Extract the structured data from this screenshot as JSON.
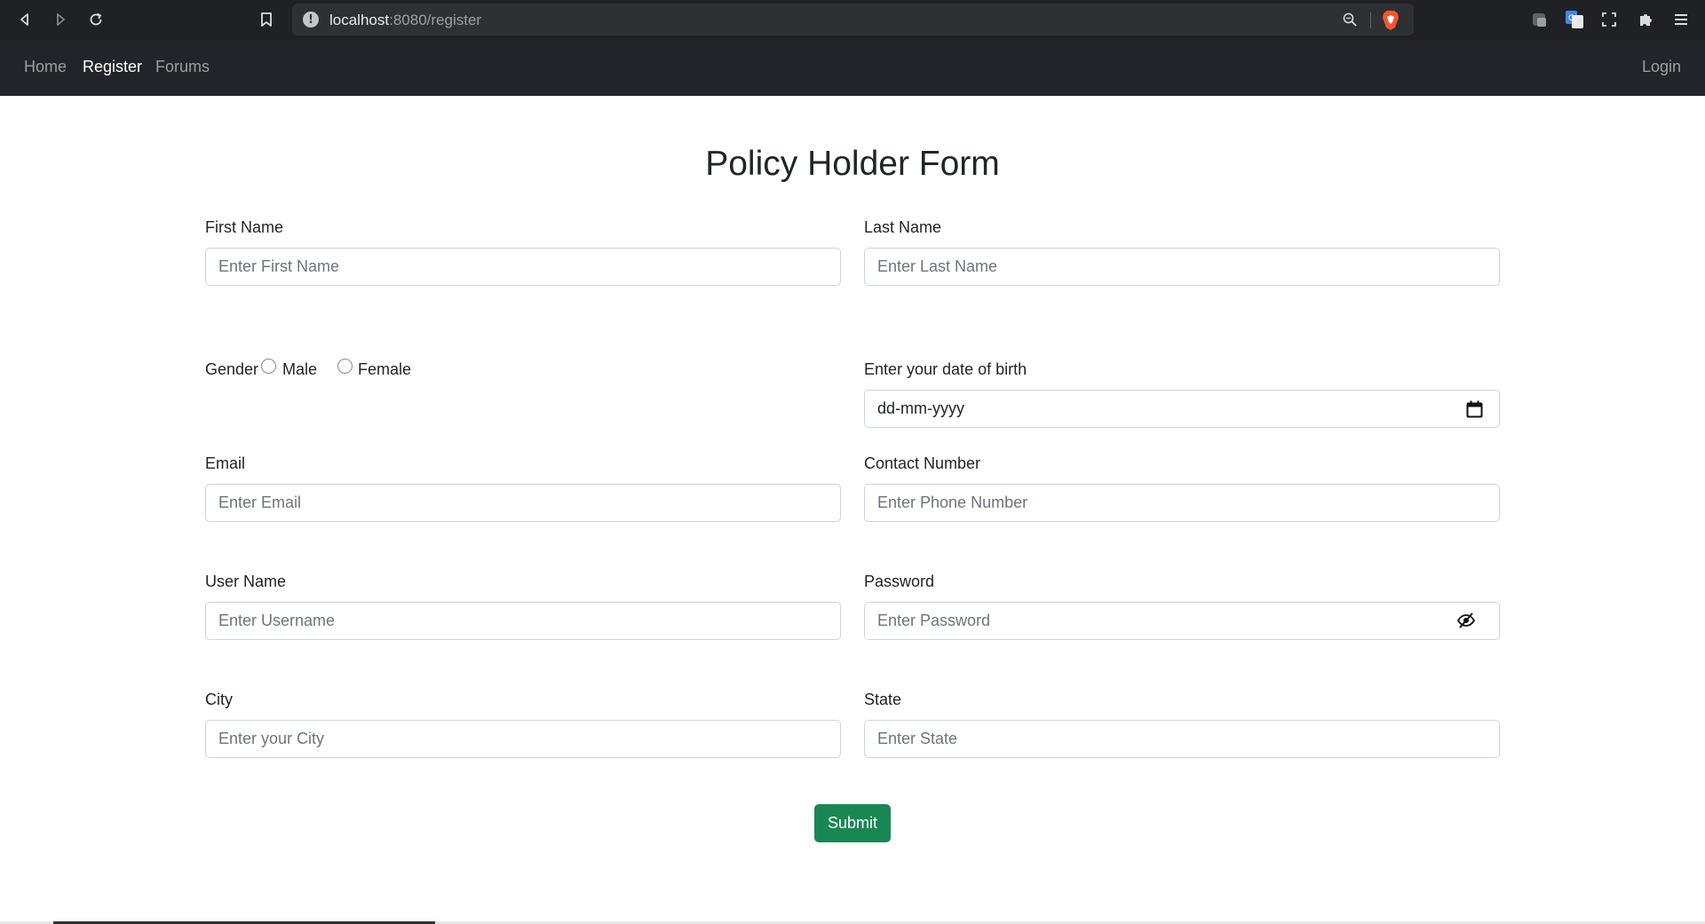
{
  "browser": {
    "url_host": "localhost",
    "url_path": ":8080/register",
    "info_glyph": "!",
    "icons": [
      "back-icon",
      "forward-icon",
      "reload-icon",
      "bookmark-icon",
      "zoom-icon",
      "brave-shield-icon",
      "extension-icon",
      "translate-icon",
      "screenshot-icon",
      "puzzle-icon",
      "menu-icon"
    ]
  },
  "navbar": {
    "home": "Home",
    "register": "Register",
    "forums": "Forums",
    "login": "Login"
  },
  "form": {
    "title": "Policy Holder Form",
    "first_name": {
      "label": "First Name",
      "placeholder": "Enter First Name"
    },
    "last_name": {
      "label": "Last Name",
      "placeholder": "Enter Last Name"
    },
    "gender": {
      "label": "Gender",
      "options": [
        "Male",
        "Female"
      ]
    },
    "dob": {
      "label": "Enter your date of birth",
      "value": "dd-mm-yyyy"
    },
    "email": {
      "label": "Email",
      "placeholder": "Enter Email"
    },
    "contact": {
      "label": "Contact Number",
      "placeholder": "Enter Phone Number"
    },
    "username": {
      "label": "User Name",
      "placeholder": "Enter Username"
    },
    "password": {
      "label": "Password",
      "placeholder": "Enter Password"
    },
    "city": {
      "label": "City",
      "placeholder": "Enter your City"
    },
    "state": {
      "label": "State",
      "placeholder": "Enter State"
    },
    "submit": "Submit"
  },
  "colors": {
    "navbar_bg": "#212529",
    "submit_bg": "#198754",
    "chrome_bg": "#202124"
  }
}
